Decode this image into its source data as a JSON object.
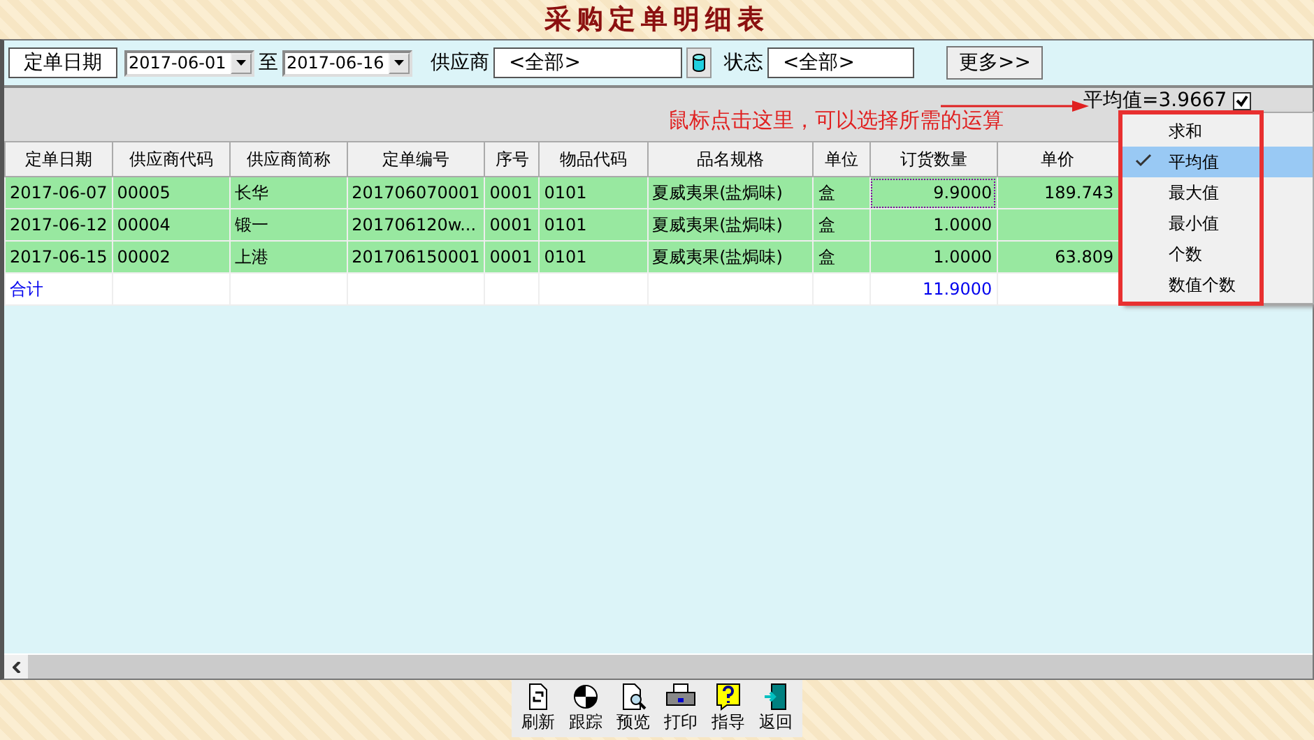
{
  "title": "采购定单明细表",
  "filters": {
    "date_label": "定单日期",
    "date_from": "2017-06-01",
    "date_sep": "至",
    "date_to": "2017-06-16",
    "supplier_label": "供应商",
    "supplier": "<全部>",
    "status_label": "状态",
    "status": "<全部>",
    "more_button": "更多>>"
  },
  "summary": {
    "annotation": "鼠标点击这里，可以选择所需的运算",
    "value": "平均值=3.9667",
    "checkbox_checked": true
  },
  "table": {
    "columns": [
      "定单日期",
      "供应商代码",
      "供应商简称",
      "定单编号",
      "序号",
      "物品代码",
      "品名规格",
      "单位",
      "订货数量",
      "单价"
    ],
    "rows": [
      {
        "focused": true,
        "cells": [
          "2017-06-07",
          "00005",
          "长华",
          "201706070001",
          "0001",
          "0101",
          "夏威夷果(盐焗味)",
          "盒",
          "9.9000",
          "189.743"
        ]
      },
      {
        "focused": false,
        "cells": [
          "2017-06-12",
          "00004",
          "锻一",
          "201706120w...",
          "0001",
          "0101",
          "夏威夷果(盐焗味)",
          "盒",
          "1.0000"
        ]
      },
      {
        "focused": false,
        "cells": [
          "2017-06-15",
          "00002",
          "上港",
          "201706150001",
          "0001",
          "0101",
          "夏威夷果(盐焗味)",
          "盒",
          "1.0000",
          "63.809"
        ]
      }
    ],
    "total": {
      "label": "合计",
      "quantity": "11.9000"
    }
  },
  "menu": [
    {
      "label": "求和",
      "selected": false
    },
    {
      "label": "平均值",
      "selected": true
    },
    {
      "label": "最大值",
      "selected": false
    },
    {
      "label": "最小值",
      "selected": false
    },
    {
      "label": "个数",
      "selected": false
    },
    {
      "label": "数值个数",
      "selected": false
    }
  ],
  "footer_buttons": [
    {
      "kind": "refresh",
      "label": "刷新"
    },
    {
      "kind": "track",
      "label": "跟踪"
    },
    {
      "kind": "preview",
      "label": "预览"
    },
    {
      "kind": "print",
      "label": "打印"
    },
    {
      "kind": "help",
      "label": "指导"
    },
    {
      "kind": "return",
      "label": "返回"
    }
  ]
}
